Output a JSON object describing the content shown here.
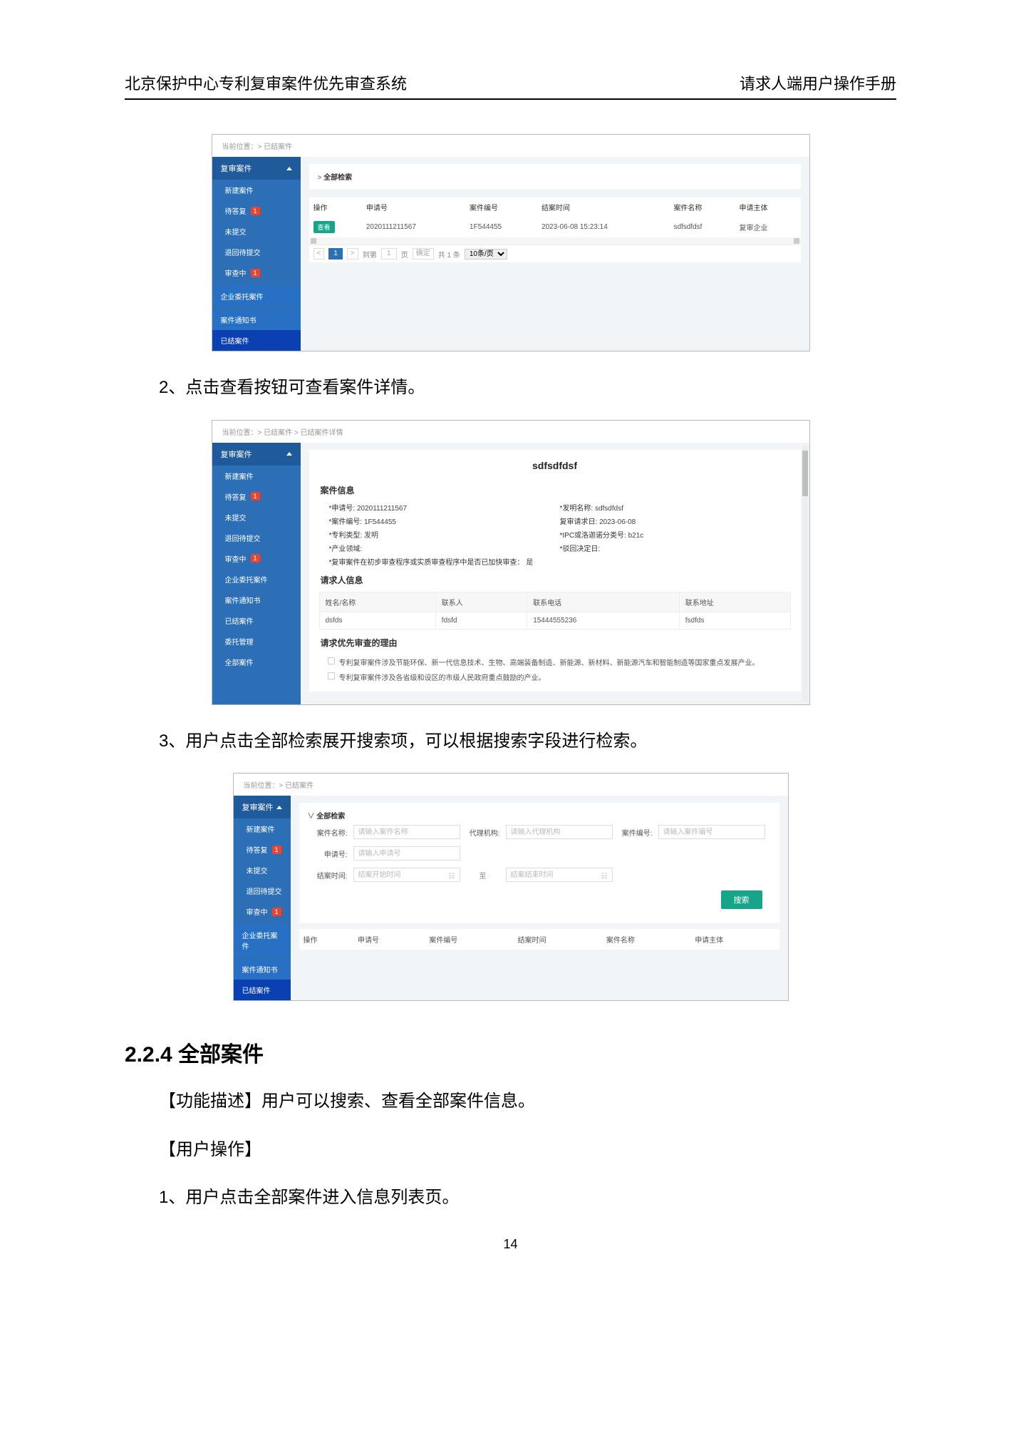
{
  "doc": {
    "header_left": "北京保护中心专利复审案件优先审查系统",
    "header_right": "请求人端用户操作手册",
    "page_number": "14",
    "para1": "2、点击查看按钮可查看案件详情。",
    "para2": "3、用户点击全部检索展开搜索项，可以根据搜索字段进行检索。",
    "heading": "2.2.4  全部案件",
    "func_desc": "【功能描述】用户可以搜索、查看全部案件信息。",
    "user_op": "【用户操作】",
    "step1": "1、用户点击全部案件进入信息列表页。"
  },
  "sidebar": {
    "header": "复审案件",
    "items": [
      {
        "label": "新建案件"
      },
      {
        "label": "待答复",
        "badge": "1"
      },
      {
        "label": "未提交"
      },
      {
        "label": "退回待提交"
      },
      {
        "label": "审查中",
        "badge": "1"
      },
      {
        "section": true,
        "label": "企业委托案件"
      },
      {
        "section": true,
        "label": "案件通知书"
      },
      {
        "active": true,
        "label": "已结案件"
      }
    ],
    "items_detail": [
      {
        "label": "新建案件"
      },
      {
        "label": "待答复",
        "badge": "1"
      },
      {
        "label": "未提交"
      },
      {
        "label": "退回待提交"
      },
      {
        "label": "审查中",
        "badge": "1"
      },
      {
        "label": "企业委托案件"
      },
      {
        "label": "案件通知书"
      },
      {
        "label": "已结案件"
      },
      {
        "label": "委托管理"
      },
      {
        "label": "全部案件"
      }
    ]
  },
  "ss1": {
    "breadcrumb": "当前位置：> 已结案件",
    "collapse": "全部检索",
    "thead": [
      "操作",
      "申请号",
      "案件编号",
      "结案时间",
      "案件名称",
      "申请主体"
    ],
    "row": {
      "btn": "查看",
      "app_no": "2020111211567",
      "case_no": "1F544455",
      "close_time": "2023-06-08 15:23:14",
      "case_name": "sdfsdfdsf",
      "applicant": "复审企业"
    },
    "pager": {
      "first_page": "1",
      "goto": "到第",
      "page_unit": "页",
      "confirm": "确定",
      "total": "共 1 条",
      "page_size": "10条/页"
    }
  },
  "ss2": {
    "breadcrumb": "当前位置：> 已结案件 > 已结案件详情",
    "title": "sdfsdfdsf",
    "section_case": "案件信息",
    "kv": {
      "app_no_k": "*申请号:",
      "app_no_v": "2020111211567",
      "inv_name_k": "*发明名称:",
      "inv_name_v": "sdfsdfdsf",
      "case_no_k": "*案件编号:",
      "case_no_v": "1F544455",
      "req_date_k": "复审请求日:",
      "req_date_v": "2023-06-08",
      "patent_type_k": "*专利类型:",
      "patent_type_v": "发明",
      "ipc_k": "*IPC或洛迦诺分类号:",
      "ipc_v": "b21c",
      "industry_k": "*产业领域:",
      "reject_date_k": "*驳回决定日:",
      "fast_k": "*复审案件在初步审查程序或实质审查程序中是否已加快审查：",
      "fast_v": "是"
    },
    "section_req": "请求人信息",
    "req_thead": [
      "姓名/名称",
      "联系人",
      "联系电话",
      "联系地址"
    ],
    "req_row": [
      "dsfds",
      "fdsfd",
      "15444555236",
      "fsdfds"
    ],
    "section_reason": "请求优先审查的理由",
    "reason1": "专利复审案件涉及节能环保、新一代信息技术、生物、高端装备制造、新能源、新材料、新能源汽车和智能制造等国家重点发展产业。",
    "reason2": "专利复审案件涉及各省级和设区的市级人民政府重点鼓励的产业。"
  },
  "ss3": {
    "breadcrumb": "当前位置：> 已结案件",
    "collapse": "全部检索",
    "labels": {
      "case_name": "案件名称:",
      "case_name_ph": "请输入案件名称",
      "agency": "代理机构:",
      "agency_ph": "请输入代理机构",
      "case_no": "案件编号:",
      "case_no_ph": "请输入案件编号",
      "app_no": "申请号:",
      "app_no_ph": "请输入申请号",
      "close_time": "结案时间:",
      "start_ph": "结案开始时间",
      "end_ph": "结案结束时间",
      "between": "至"
    },
    "search_btn": "搜索",
    "thead": [
      "操作",
      "申请号",
      "案件编号",
      "结案时间",
      "案件名称",
      "申请主体"
    ]
  }
}
